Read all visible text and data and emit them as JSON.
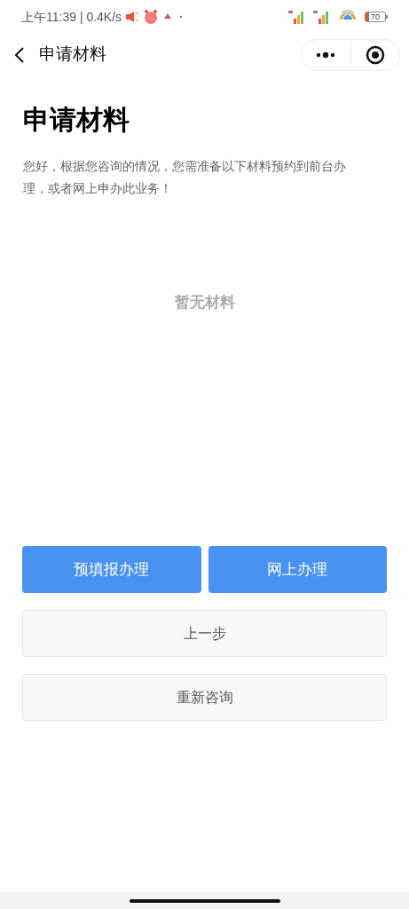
{
  "status_bar": {
    "time": "上午11:39 | 0.4K/s",
    "battery": "70"
  },
  "nav_bar": {
    "title": "申请材料"
  },
  "page": {
    "title": "申请材料",
    "description": "您好，根据您咨询的情况，您需准备以下材料预约到前台办理，或者网上申办此业务！",
    "empty_text": "暂无材料"
  },
  "actions": [
    {
      "kind": "primary",
      "label": "预填报办理"
    },
    {
      "kind": "primary",
      "label": "网上办理"
    }
  ],
  "buttons": [
    {
      "kind": "secondary",
      "label": "上一步"
    },
    {
      "kind": "secondary",
      "label": "重新咨询"
    }
  ]
}
